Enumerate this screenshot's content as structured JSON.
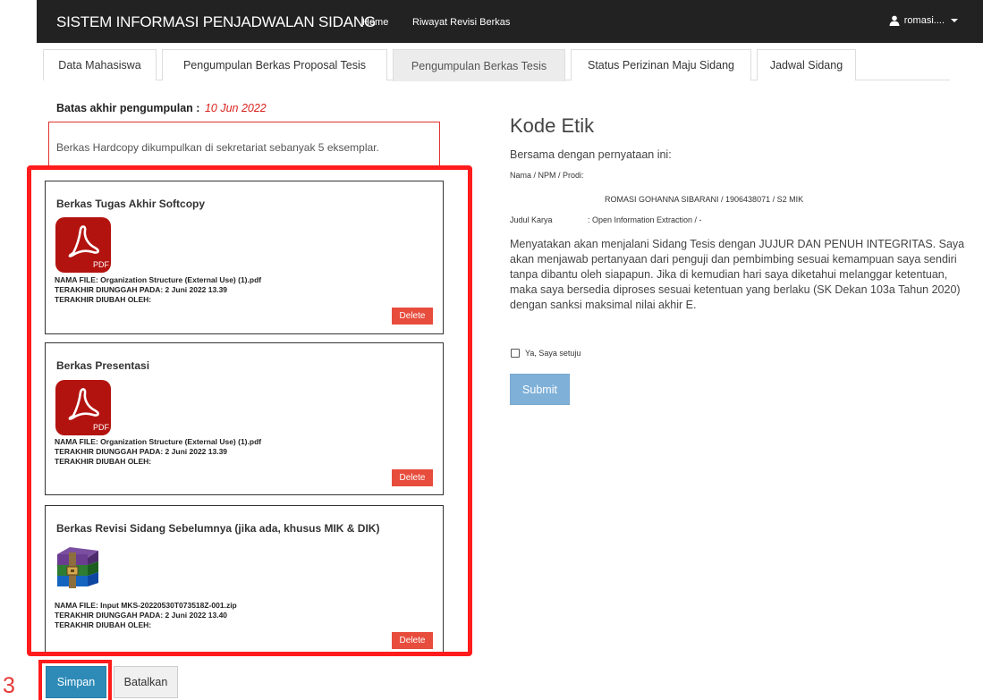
{
  "navbar": {
    "brand": "SISTEM INFORMASI PENJADWALAN SIDANG",
    "home": "Home",
    "riwayat": "Riwayat Revisi Berkas",
    "user": "romasi...."
  },
  "tabs": [
    {
      "label": "Data Mahasiswa"
    },
    {
      "label": "Pengumpulan Berkas Proposal Tesis"
    },
    {
      "label": "Pengumpulan Berkas Tesis"
    },
    {
      "label": "Status Perizinan Maju Sidang"
    },
    {
      "label": "Jadwal Sidang"
    }
  ],
  "deadline": {
    "label": "Batas akhir pengumpulan :",
    "date": "10 Jun 2022"
  },
  "hardcopy_note": "Berkas Hardcopy dikumpulkan di sekretariat sebanyak 5 eksemplar.",
  "files": [
    {
      "title": "Berkas Tugas Akhir Softcopy",
      "icon": "pdf-icon",
      "filename": "NAMA FILE: Organization Structure (External Use) (1).pdf",
      "uploaded": "TERAKHIR DIUNGGAH PADA: 2 Juni 2022 13.39",
      "changed_by": "TERAKHIR DIUBAH OLEH:",
      "delete_label": "Delete"
    },
    {
      "title": "Berkas Presentasi",
      "icon": "pdf-icon",
      "filename": "NAMA FILE: Organization Structure (External Use) (1).pdf",
      "uploaded": "TERAKHIR DIUNGGAH PADA: 2 Juni 2022 13.39",
      "changed_by": "TERAKHIR DIUBAH OLEH:",
      "delete_label": "Delete"
    },
    {
      "title": "Berkas Revisi Sidang Sebelumnya (jika ada, khusus MIK & DIK)",
      "icon": "archive-icon",
      "filename": "NAMA FILE: Input MKS-20220530T073518Z-001.zip",
      "uploaded": "TERAKHIR DIUNGGAH PADA: 2 Juni 2022 13.40",
      "changed_by": "TERAKHIR DIUBAH OLEH:",
      "delete_label": "Delete"
    }
  ],
  "actions": {
    "save": "Simpan",
    "cancel": "Batalkan"
  },
  "annotation_step": "3",
  "kode_etik": {
    "title": "Kode Etik",
    "intro": "Bersama dengan pernyataan ini:",
    "name_label": "Nama / NPM / Prodi:",
    "name_value": "ROMASI GOHANNA SIBARANI / 1906438071 / S2 MIK",
    "judul_label": "Judul Karya",
    "judul_value": ": Open Information Extraction / -",
    "statement": "Menyatakan akan menjalani Sidang Tesis dengan JUJUR DAN PENUH INTEGRITAS. Saya akan menjawab pertanyaan dari penguji dan pembimbing sesuai kemampuan saya sendiri tanpa dibantu oleh siapapun. Jika di kemudian hari saya diketahui melanggar ketentuan, maka saya bersedia diproses sesuai ketentuan yang berlaku (SK Dekan 103a Tahun 2020) dengan sanksi maksimal nilai akhir E.",
    "agree_label": "Ya, Saya setuju",
    "agree_checked": false,
    "submit": "Submit"
  },
  "colors": {
    "navbar_bg": "#222222",
    "highlight": "#ff1c1c",
    "delete": "#e74c3c",
    "save": "#2e8bb8",
    "submit": "#7fb0d8",
    "deadline_date": "#d9231d"
  }
}
